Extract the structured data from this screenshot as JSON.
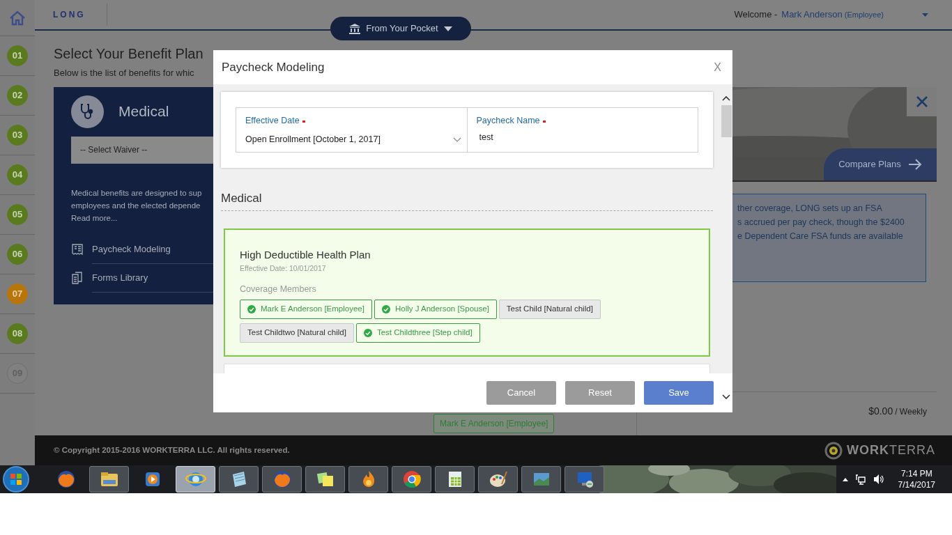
{
  "sidebar": {
    "steps": [
      {
        "label": "01",
        "kind": "done"
      },
      {
        "label": "02",
        "kind": "done"
      },
      {
        "label": "03",
        "kind": "done"
      },
      {
        "label": "04",
        "kind": "done"
      },
      {
        "label": "05",
        "kind": "done"
      },
      {
        "label": "06",
        "kind": "done"
      },
      {
        "label": "07",
        "kind": "current"
      },
      {
        "label": "08",
        "kind": "done"
      },
      {
        "label": "09",
        "kind": "pending"
      }
    ]
  },
  "header": {
    "logo": "LONG",
    "welcome": "Welcome -",
    "user_name": "Mark Anderson",
    "user_role": "(Employee)",
    "pocket_button": "From Your Pocket"
  },
  "page": {
    "title": "Select Your Benefit Plan",
    "subtitle": "Below is the list of benefits for whic"
  },
  "benefit_card": {
    "title": "Medical",
    "waiver_select": "-- Select Waiver --",
    "description": [
      "Medical benefits are designed to sup",
      "employees and the elected depende",
      "Read more..."
    ],
    "links": [
      "Paycheck Modeling",
      "Forms Library"
    ]
  },
  "plan_panel": {
    "compare_button": "Compare Plans",
    "info_lines": [
      "ther coverage, LONG sets up an FSA",
      "s accrued per pay check, though the $2400",
      "e Dependent Care FSA funds are available"
    ],
    "cost": "$0.00",
    "cost_period": "/ Weekly",
    "member_chip": "Mark E Anderson [Employee]"
  },
  "footer": {
    "copyright": "© Copyright 2015-2016 WORKTERRA LLC. All rights reserved.",
    "brand_bold": "WORK",
    "brand_light": "TERRA"
  },
  "modal": {
    "title": "Paycheck Modeling",
    "close": "X",
    "fields": [
      {
        "kind": "select",
        "label": "Effective Date",
        "required": true,
        "value": "Open Enrollment [October 1, 2017]"
      },
      {
        "kind": "text",
        "label": "Paycheck Name",
        "required": true,
        "value": "test"
      }
    ],
    "section": "Medical",
    "plan": {
      "name": "High Deductible Health Plan",
      "selected": true,
      "effective": "Effective Date: 10/01/2017",
      "members_label": "Coverage Members",
      "members": [
        {
          "name": "Mark E Anderson [Employee]",
          "selected": true
        },
        {
          "name": "Holly J Anderson [Spouse]",
          "selected": true
        },
        {
          "name": "Test Child [Natural child]",
          "selected": false
        },
        {
          "name": "Test Childtwo [Natural child]",
          "selected": false
        },
        {
          "name": "Test Childthree [Step child]",
          "selected": true
        }
      ]
    },
    "buttons": [
      {
        "label": "Cancel",
        "kind": "secondary"
      },
      {
        "label": "Reset",
        "kind": "secondary"
      },
      {
        "label": "Save",
        "kind": "primary"
      }
    ]
  },
  "taskbar": {
    "time": "7:14 PM",
    "date": "7/14/2017"
  }
}
